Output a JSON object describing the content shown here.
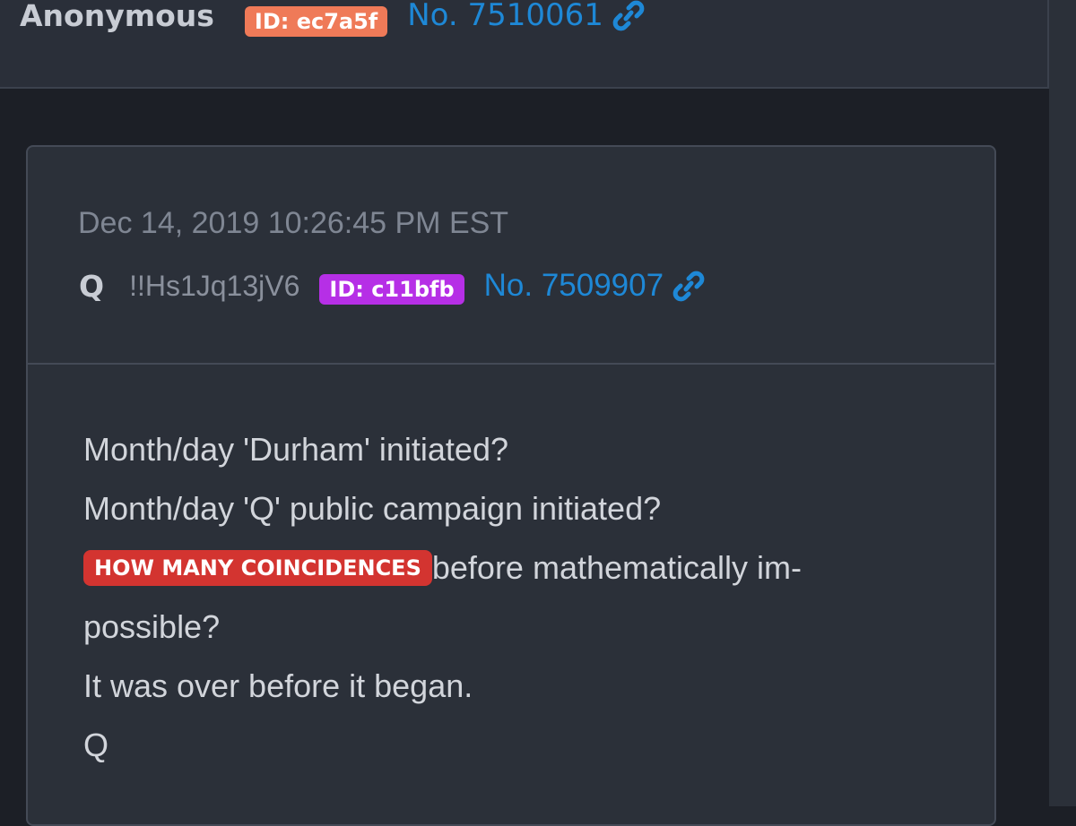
{
  "top_post": {
    "author": "Anonymous",
    "id_badge": "ID: ec7a5f",
    "post_number": "No. 7510061",
    "link_icon": "link-icon"
  },
  "quoted_post": {
    "timestamp": "Dec 14, 2019 10:26:45 PM EST",
    "author": "Q",
    "tripcode": "!!Hs1Jq13jV6",
    "id_badge": "ID: c11bfb",
    "post_number": "No. 7509907",
    "link_icon": "link-icon",
    "body": {
      "line1": "Month/day 'Durham' initiated?",
      "line2": "Month/day 'Q' public campaign initiated?",
      "highlight": "HOW MANY COINCIDENCES",
      "line3_rest": "before mathematically im-",
      "line4": "possible?",
      "line5": "It was over before it began.",
      "signature": "Q"
    }
  },
  "colors": {
    "background": "#1c1f26",
    "panel": "#2a2f39",
    "link_blue": "#1e88d6",
    "badge_orange": "#ef7a58",
    "badge_purple": "#b62fe6",
    "highlight_red": "#d33430"
  }
}
